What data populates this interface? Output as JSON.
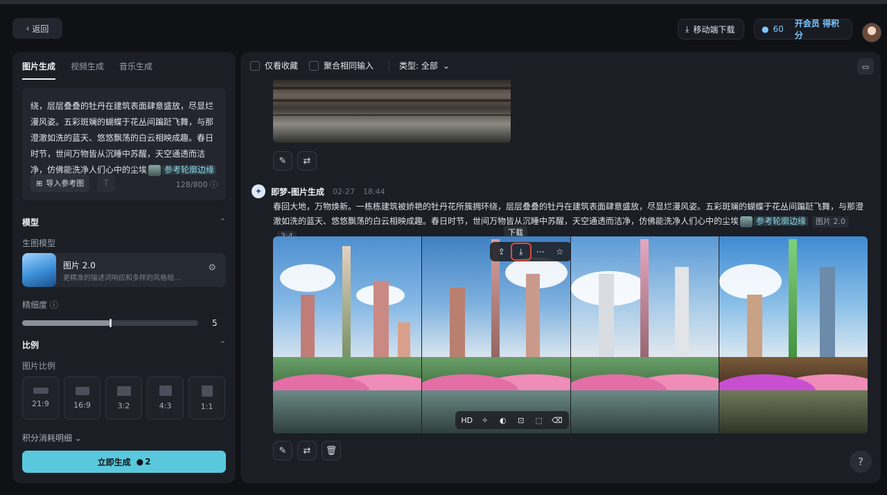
{
  "topbar": {
    "back_label": "返回",
    "mobile_download_label": "移动端下载",
    "credits": "60",
    "vip_label": "开会员 得积分"
  },
  "left": {
    "tabs": [
      {
        "label": "图片生成",
        "active": true
      },
      {
        "label": "视频生成",
        "active": false
      },
      {
        "label": "音乐生成",
        "active": false
      }
    ],
    "prompt_text": "万物焕新。一栋栋建筑被娇艳的牡丹花所簇拥环绕，层层叠叠的牡丹在建筑表面肆意盛放，尽显烂漫风姿。五彩斑斓的蝴蝶于花丛间蹁跹飞舞，与那澄澈如洗的蓝天、悠悠飘荡的白云相映成趣。春日时节，世间万物皆从沉睡中苏醒，天空通透而洁净，仿佛能洗净人们心中的尘埃",
    "ref_tag": "参考轮廓边缘",
    "import_ref_label": "导入参考图",
    "char_count": "128/800",
    "model_section": "模型",
    "model_sub": "生图模型",
    "model_name": "图片 2.0",
    "model_desc": "更精准的描述词响应和多样的风格组...",
    "fineness_label": "精细度",
    "fineness_value": "5",
    "fineness_fraction": 0.5,
    "ratio_section": "比例",
    "ratio_sub": "图片比例",
    "ratios": [
      "21:9",
      "16:9",
      "3:2",
      "4:3",
      "1:1"
    ],
    "cost_detail_label": "积分消耗明细",
    "generate_label": "立即生成",
    "generate_cost": "2"
  },
  "main": {
    "filter_favorites": "仅看收藏",
    "filter_merge": "聚合相同输入",
    "filter_type": "类型: 全部",
    "gen_title": "即梦-图片生成",
    "gen_date": "02-27",
    "gen_time": "18:44",
    "gen_prompt": "春回大地，万物焕新。一栋栋建筑被娇艳的牡丹花所簇拥环绕，层层叠叠的牡丹在建筑表面肆意盛放，尽显烂漫风姿。五彩斑斓的蝴蝶于花丛间蹁跹飞舞，与那澄澈如洗的蓝天、悠悠飘荡的白云相映成趣。春日时节，世间万物皆从沉睡中苏醒，天空通透而洁净，仿佛能洗净人们心中的尘埃",
    "gen_ref_tag": "参考轮廓边缘",
    "gen_model_tag": "图片 2.0",
    "gen_ratio_tag": "3:4",
    "tooltip": "下载",
    "hd_label": "HD"
  },
  "colors": {
    "accent": "#5ac8dc",
    "highlight_box": "#e04a36",
    "link": "#7fc8ff"
  }
}
